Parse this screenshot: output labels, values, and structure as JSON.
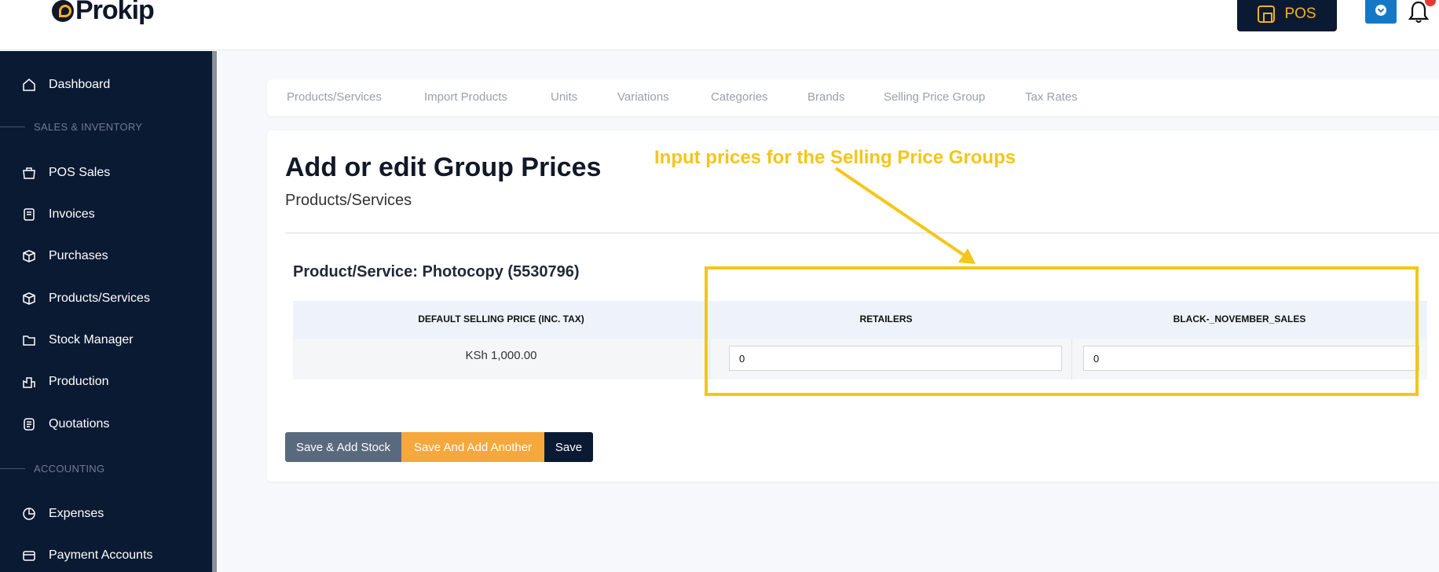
{
  "brand": {
    "name": "Prokip"
  },
  "header": {
    "pos_label": "POS"
  },
  "sidebar": {
    "items": [
      {
        "label": "Dashboard",
        "icon": "home-icon"
      },
      {
        "section": "SALES & INVENTORY"
      },
      {
        "label": "POS Sales",
        "icon": "basket-icon"
      },
      {
        "label": "Invoices",
        "icon": "invoice-icon"
      },
      {
        "label": "Purchases",
        "icon": "box-icon"
      },
      {
        "label": "Products/Services",
        "icon": "cube-icon"
      },
      {
        "label": "Stock Manager",
        "icon": "folder-icon"
      },
      {
        "label": "Production",
        "icon": "factory-icon"
      },
      {
        "label": "Quotations",
        "icon": "document-icon"
      },
      {
        "section": "ACCOUNTING"
      },
      {
        "label": "Expenses",
        "icon": "pie-chart-icon"
      },
      {
        "label": "Payment Accounts",
        "icon": "wallet-icon"
      }
    ]
  },
  "tabs": [
    "Products/Services",
    "Import Products",
    "Units",
    "Variations",
    "Categories",
    "Brands",
    "Selling Price Group",
    "Tax Rates"
  ],
  "page": {
    "title": "Add or edit Group Prices",
    "subtitle": "Products/Services",
    "product_heading": "Product/Service: Photocopy (5530796)"
  },
  "table": {
    "headers": [
      "DEFAULT SELLING PRICE (INC. TAX)",
      "RETAILERS",
      "BLACK-_NOVEMBER_SALES"
    ],
    "default_price": "KSh 1,000.00",
    "group_prices": [
      "0",
      "0"
    ]
  },
  "buttons": {
    "save_add_stock": "Save & Add Stock",
    "save_add_another": "Save And Add Another",
    "save": "Save"
  },
  "annotation": {
    "text": "Input prices for the Selling Price Groups",
    "color": "#f5c518"
  },
  "colors": {
    "sidebar_bg": "#0b1a33",
    "accent": "#f5b21a",
    "save_another": "#f6a83c",
    "save_stock": "#5a6a7e"
  }
}
